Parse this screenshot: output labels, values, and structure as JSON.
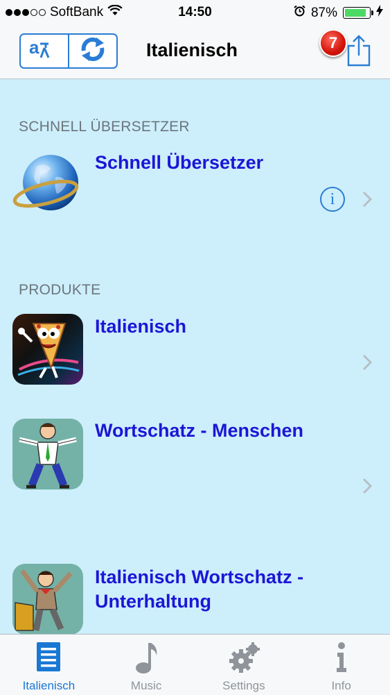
{
  "status_bar": {
    "carrier": "SoftBank",
    "time": "14:50",
    "battery_percent": "87%",
    "battery_level": 0.87,
    "signal_bars_filled": 3,
    "signal_bars_total": 5
  },
  "nav": {
    "title": "Italienisch",
    "badge_count": "7",
    "translate_icon": "translate-icon",
    "refresh_icon": "refresh-icon",
    "share_icon": "share-icon"
  },
  "sections": {
    "quick": {
      "header": "SCHNELL ÜBERSETZER",
      "item_title": "Schnell Übersetzer"
    },
    "products": {
      "header": "PRODUKTE",
      "items": [
        {
          "title": "Italienisch"
        },
        {
          "title": "Wortschatz - Menschen"
        },
        {
          "title_line1": "Italienisch Wortschatz -",
          "title_line2": "Unterhaltung"
        }
      ]
    }
  },
  "tabbar": {
    "tabs": [
      {
        "label": "Italienisch",
        "icon": "list-icon",
        "active": true
      },
      {
        "label": "Music",
        "icon": "music-note-icon",
        "active": false
      },
      {
        "label": "Settings",
        "icon": "gear-icon",
        "active": false
      },
      {
        "label": "Info",
        "icon": "info-icon",
        "active": false
      }
    ]
  },
  "colors": {
    "accent": "#2a7dd6",
    "link_title": "#1c16d6",
    "background": "#cdeefb",
    "badge": "#d3130a"
  }
}
